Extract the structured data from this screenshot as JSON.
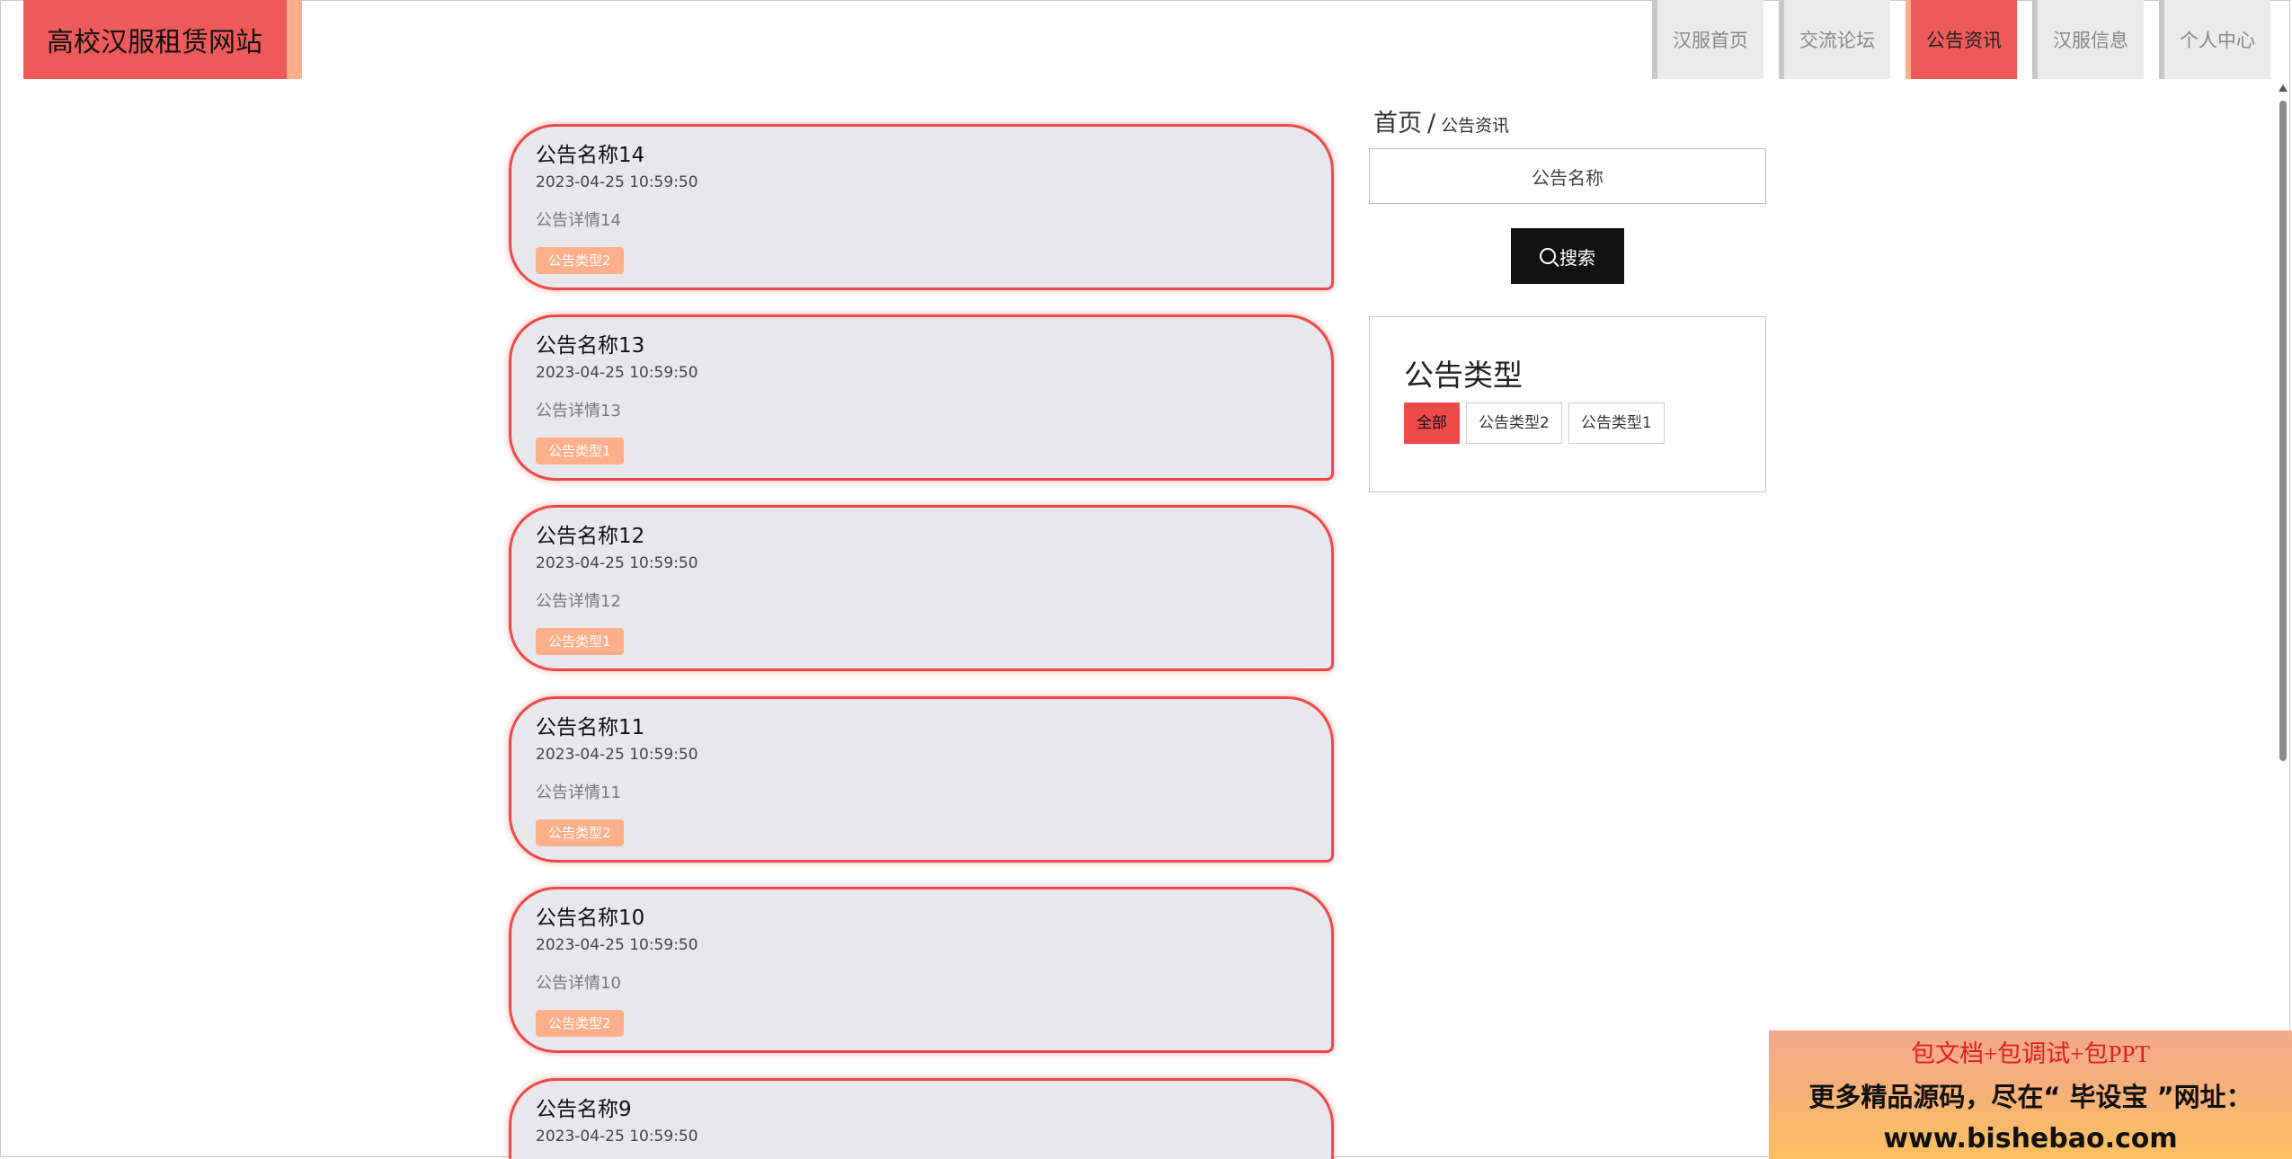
{
  "header": {
    "site_title": "高校汉服租赁网站",
    "nav": [
      {
        "label": "汉服首页"
      },
      {
        "label": "交流论坛"
      },
      {
        "label": "公告资讯"
      },
      {
        "label": "汉服信息"
      },
      {
        "label": "个人中心"
      }
    ],
    "active_nav": "公告资讯"
  },
  "notices": [
    {
      "title": "公告名称14",
      "time": "2023-04-25 10:59:50",
      "detail": "公告详情14",
      "type": "公告类型2"
    },
    {
      "title": "公告名称13",
      "time": "2023-04-25 10:59:50",
      "detail": "公告详情13",
      "type": "公告类型1"
    },
    {
      "title": "公告名称12",
      "time": "2023-04-25 10:59:50",
      "detail": "公告详情12",
      "type": "公告类型1"
    },
    {
      "title": "公告名称11",
      "time": "2023-04-25 10:59:50",
      "detail": "公告详情11",
      "type": "公告类型2"
    },
    {
      "title": "公告名称10",
      "time": "2023-04-25 10:59:50",
      "detail": "公告详情10",
      "type": "公告类型2"
    },
    {
      "title": "公告名称9",
      "time": "2023-04-25 10:59:50",
      "detail": "",
      "type": ""
    }
  ],
  "breadcrumb": {
    "home": "首页",
    "separator": "/",
    "current": "公告资讯"
  },
  "search": {
    "placeholder": "公告名称",
    "button_label": "搜索"
  },
  "type_filter": {
    "title": "公告类型",
    "options": [
      "全部",
      "公告类型2",
      "公告类型1"
    ],
    "selected": "全部"
  },
  "ad": {
    "line1": "包文档+包调试+包PPT",
    "line2": "更多精品源码，尽在“ 毕设宝 ”网址：",
    "line3": "www.bishebao.com"
  },
  "colors": {
    "accent": "#ee5a5a",
    "tag": "#ffb08a",
    "card_bg": "#e8e8ec"
  }
}
